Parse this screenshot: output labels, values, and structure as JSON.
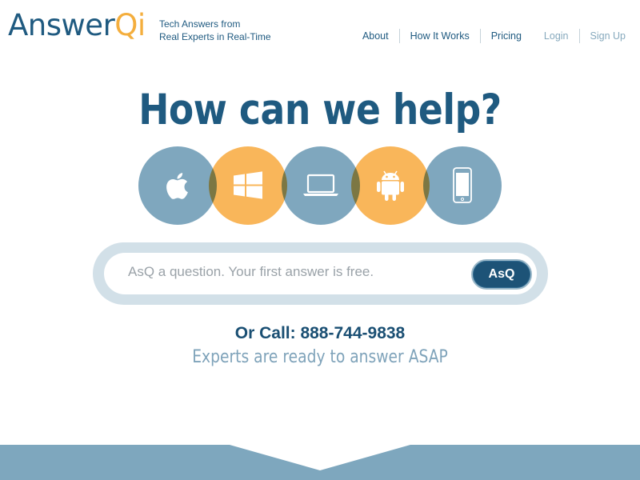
{
  "brand": {
    "name_main": "Answer",
    "name_accent": "Qi",
    "tagline_line1": "Tech Answers from",
    "tagline_line2": "Real Experts in Real-Time",
    "colors": {
      "primary": "#1f5a80",
      "accent": "#f4ae3d",
      "light": "#7fa7be"
    }
  },
  "nav": {
    "about": "About",
    "how_it_works": "How It Works",
    "pricing": "Pricing",
    "login": "Login",
    "sign_up": "Sign Up"
  },
  "headline": "How can we help?",
  "platforms": [
    {
      "icon": "apple-icon",
      "color": "blue"
    },
    {
      "icon": "windows-icon",
      "color": "orange"
    },
    {
      "icon": "laptop-icon",
      "color": "blue"
    },
    {
      "icon": "android-icon",
      "color": "orange"
    },
    {
      "icon": "phone-icon",
      "color": "blue"
    }
  ],
  "search": {
    "placeholder": "AsQ a question. Your first answer is free.",
    "button": "AsQ"
  },
  "call": {
    "text": "Or Call: 888-744-9838",
    "subtext": "Experts are ready to answer ASAP"
  }
}
